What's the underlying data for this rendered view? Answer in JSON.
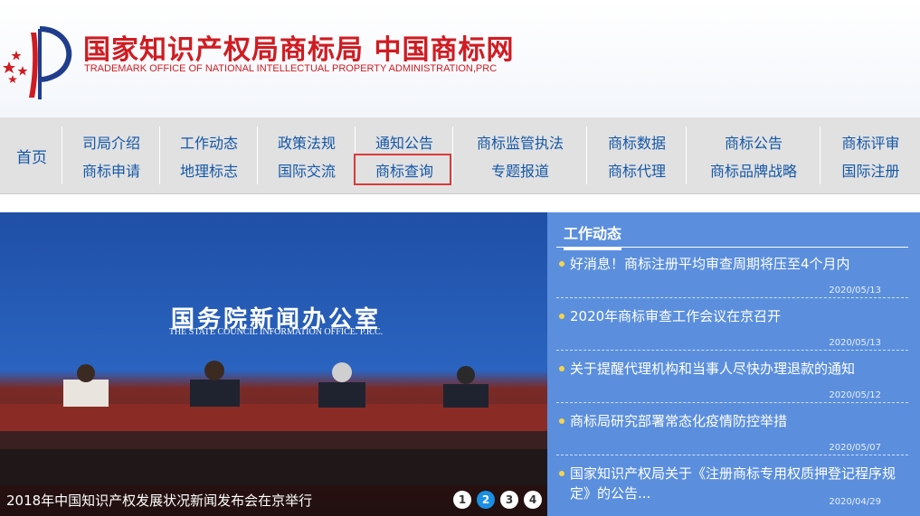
{
  "header": {
    "title": "国家知识产权局商标局 中国商标网",
    "subtitle": "TRADEMARK OFFICE OF NATIONAL INTELLECTUAL PROPERTY ADMINISTRATION,PRC",
    "emblem_icon": "trademark-office-emblem-icon"
  },
  "nav": {
    "home": "首页",
    "columns": [
      {
        "top": "司局介绍",
        "bottom": "商标申请"
      },
      {
        "top": "工作动态",
        "bottom": "地理标志"
      },
      {
        "top": "政策法规",
        "bottom": "国际交流"
      },
      {
        "top": "通知公告",
        "bottom": "商标查询"
      },
      {
        "top": "商标监管执法",
        "bottom": "专题报道"
      },
      {
        "top": "商标数据",
        "bottom": "商标代理"
      },
      {
        "top": "商标公告",
        "bottom": "商标品牌战略"
      },
      {
        "top": "商标评审",
        "bottom": "国际注册"
      }
    ],
    "highlighted_item": "商标查询",
    "highlight_color": "#d93a3a"
  },
  "banner": {
    "org_cn": "国务院新闻办公室",
    "org_en": "THE STATE COUNCIL INFORMATION OFFICE. P.R.C.",
    "caption": "2018年中国知识产权发展状况新闻发布会在京举行",
    "pages": [
      "1",
      "2",
      "3",
      "4"
    ],
    "active_page": "2"
  },
  "news": {
    "tab_label": "工作动态",
    "items": [
      {
        "title": "好消息！商标注册平均审查周期将压至4个月内",
        "date": "2020/05/13"
      },
      {
        "title": "2020年商标审查工作会议在京召开",
        "date": "2020/05/13"
      },
      {
        "title": "关于提醒代理机构和当事人尽快办理退款的通知",
        "date": "2020/05/12"
      },
      {
        "title": "商标局研究部署常态化疫情防控举措",
        "date": "2020/05/07"
      },
      {
        "title": "国家知识产权局关于《注册商标专用权质押登记程序规定》的公告...",
        "date": "2020/04/29"
      }
    ]
  },
  "colors": {
    "brand_red": "#cf1c22",
    "nav_link": "#1457a8",
    "nav_bg": "#e1e1e1",
    "news_bg": "#5b8fdd",
    "bullet": "#f6d44a"
  }
}
